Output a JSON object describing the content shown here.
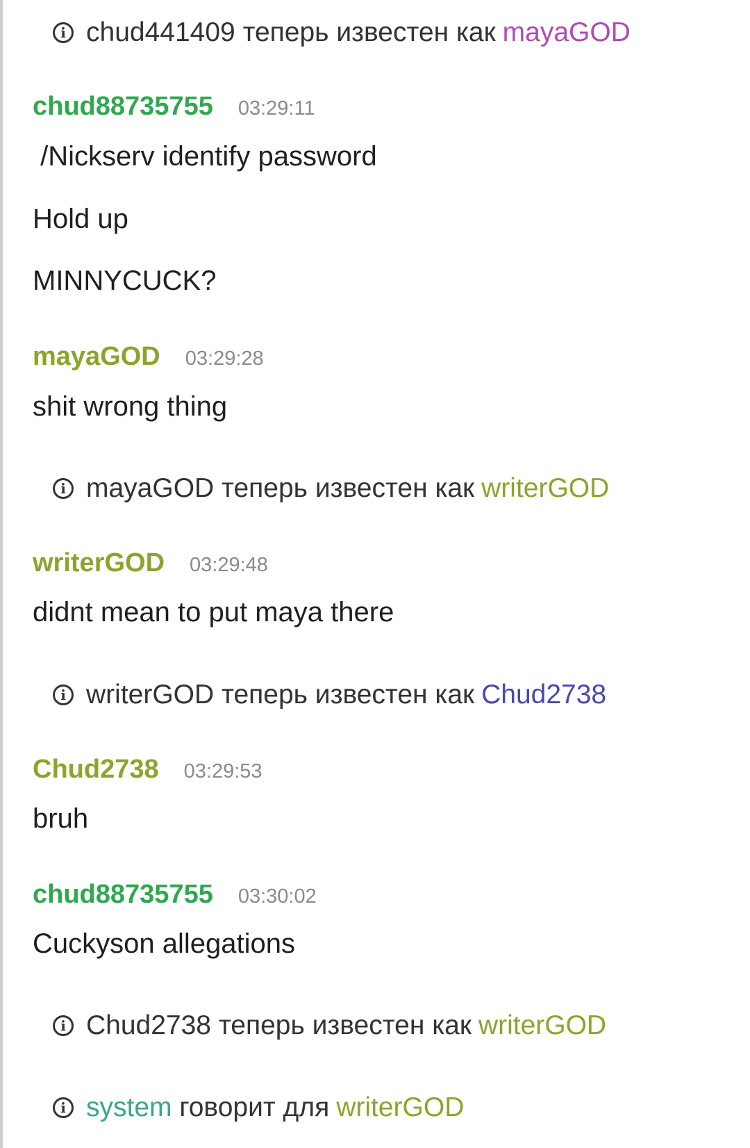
{
  "colors": {
    "nick_green": "#2fa84f",
    "nick_olive": "#8aa52c",
    "nick_magenta": "#b04bb4",
    "nick_indigo": "#4a4aa8",
    "nick_teal": "#3aa58a",
    "timestamp_gray": "#8a8a8a"
  },
  "feed": {
    "notice_1": {
      "icon": "info-icon",
      "old": "chud441409",
      "text": "теперь известен как",
      "new": "mayaGOD"
    },
    "message_1": {
      "author": "chud88735755",
      "time": "03:29:11",
      "lines": [
        " /Nickserv identify password",
        "Hold up",
        "MINNYCUCK?"
      ]
    },
    "message_2": {
      "author": "mayaGOD",
      "time": "03:29:28",
      "lines": [
        "shit wrong thing"
      ]
    },
    "notice_2": {
      "icon": "info-icon",
      "old": "mayaGOD",
      "text": "теперь известен как",
      "new": "writerGOD"
    },
    "message_3": {
      "author": "writerGOD",
      "time": "03:29:48",
      "lines": [
        "didnt mean to put maya there"
      ]
    },
    "notice_3": {
      "icon": "info-icon",
      "old": "writerGOD",
      "text": "теперь известен как",
      "new": "Chud2738"
    },
    "message_4": {
      "author": "Chud2738",
      "time": "03:29:53",
      "lines": [
        "bruh"
      ]
    },
    "message_5": {
      "author": "chud88735755",
      "time": "03:30:02",
      "lines": [
        "Cuckyson allegations"
      ]
    },
    "notice_4": {
      "icon": "info-icon",
      "old": "Chud2738",
      "text": "теперь известен как",
      "new": "writerGOD"
    },
    "notice_5": {
      "icon": "info-icon",
      "sender": "system",
      "text": "говорит для",
      "target": "writerGOD"
    }
  }
}
